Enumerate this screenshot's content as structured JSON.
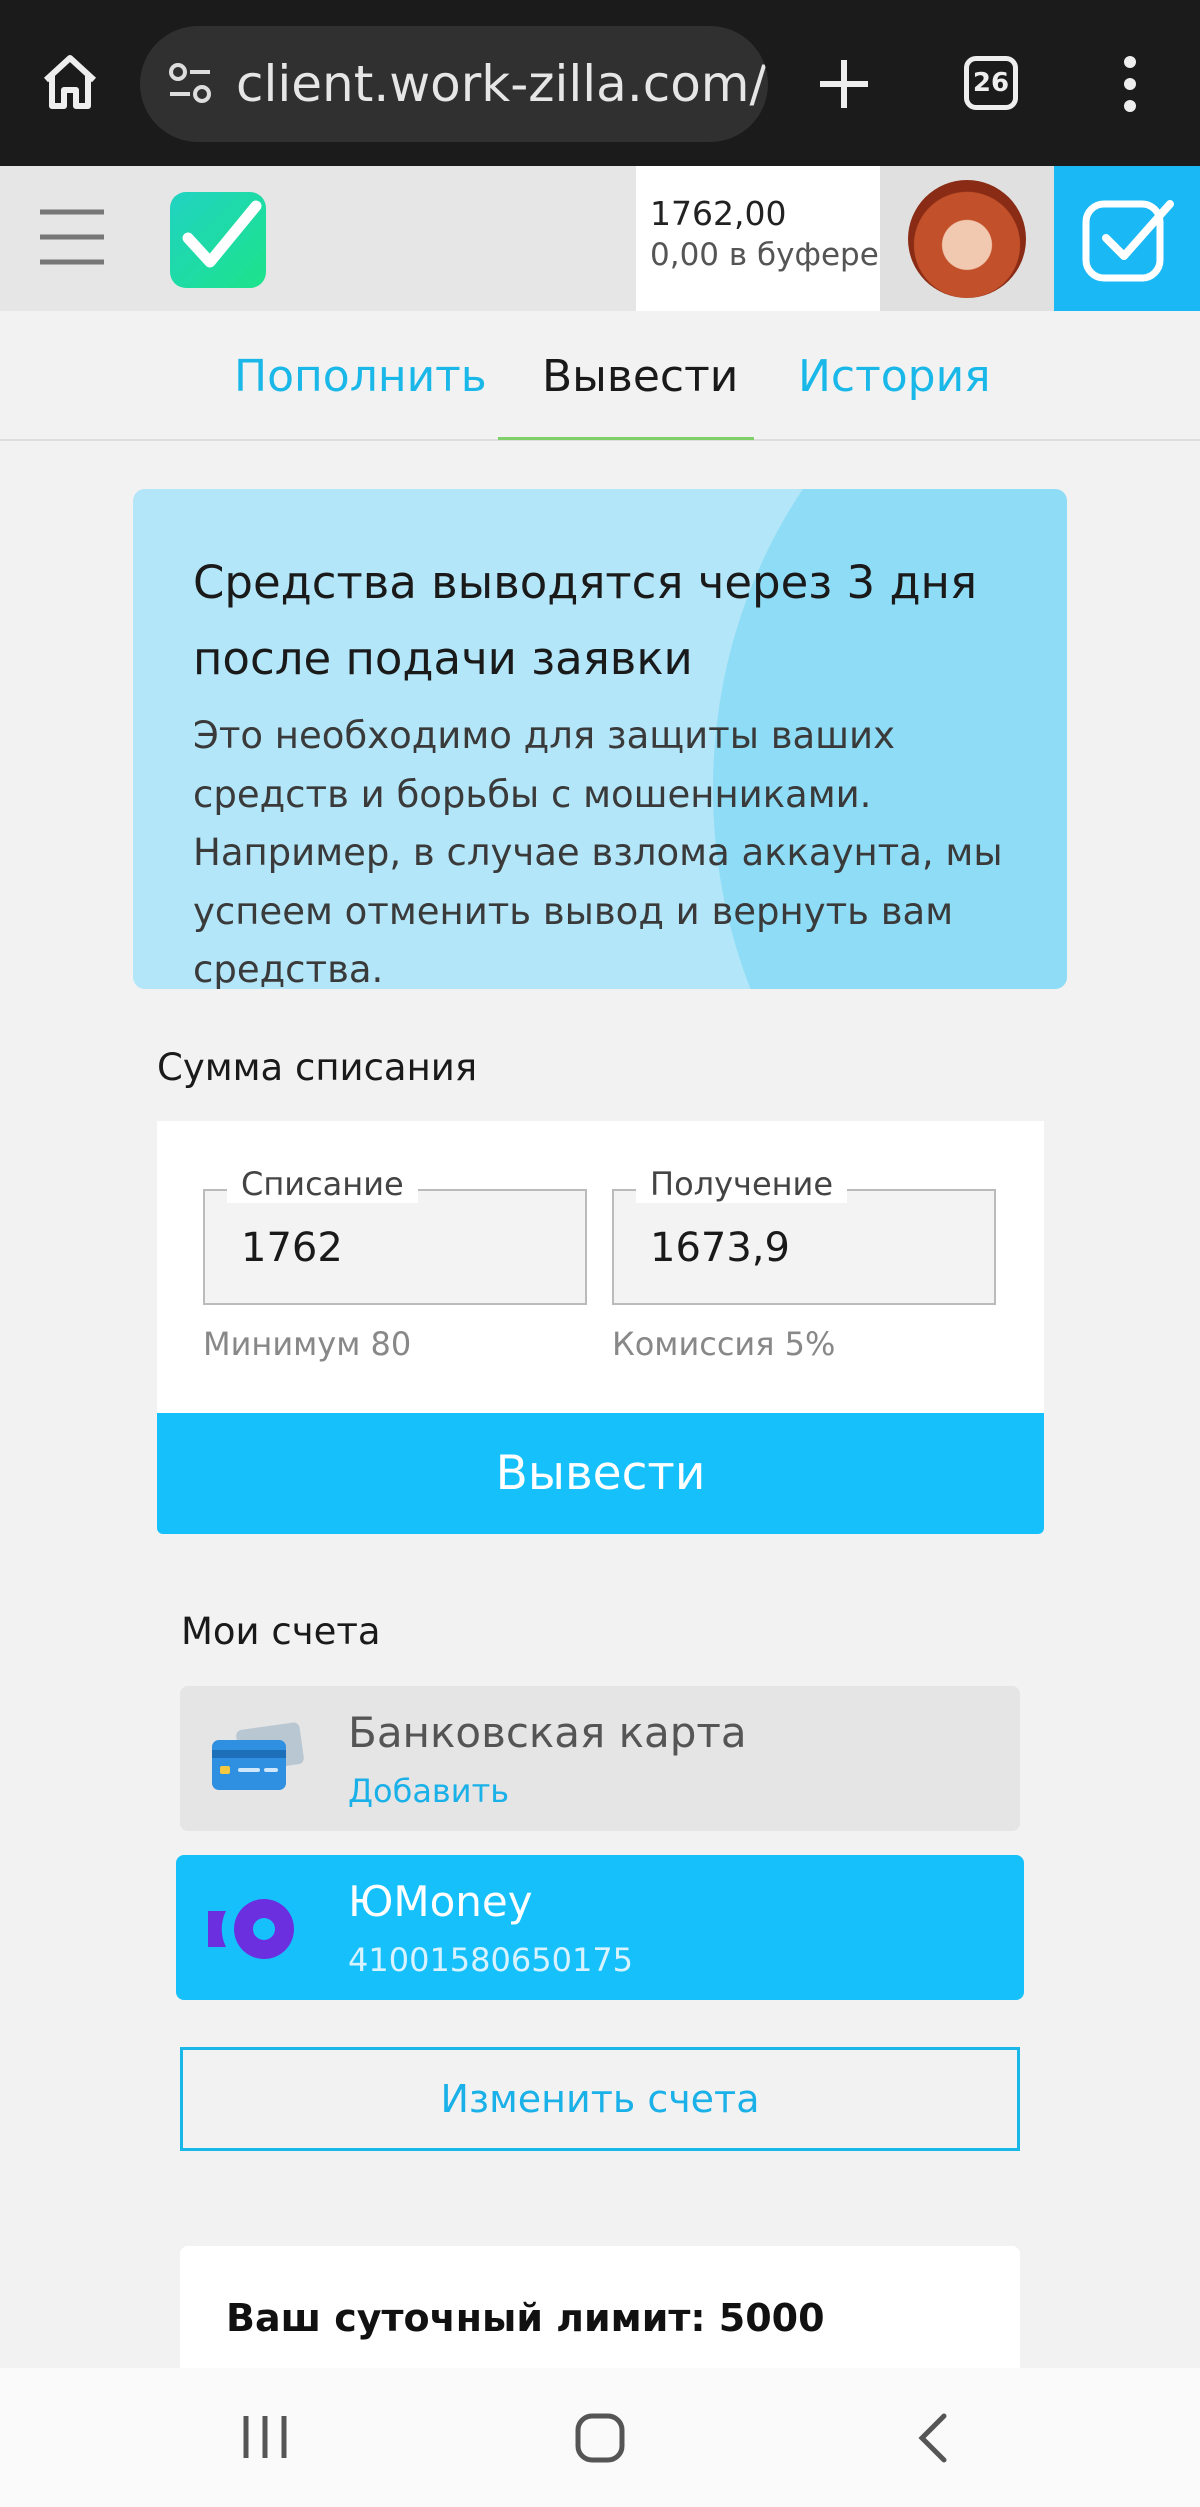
{
  "browser": {
    "url": "client.work-zilla.com/n",
    "tab_count": "26"
  },
  "header": {
    "balance": "1762,00",
    "buffer": "0,00 в буфере"
  },
  "tabs": [
    {
      "label": "Пополнить",
      "active": false
    },
    {
      "label": "Вывести",
      "active": true
    },
    {
      "label": "История",
      "active": false
    }
  ],
  "info": {
    "title": "Средства выводятся через 3 дня после подачи заявки",
    "text": "Это необходимо для защиты ваших средств и борьбы с мошенниками. Например, в случае взлома аккаунта, мы успеем отменить вывод и вернуть вам средства."
  },
  "amount": {
    "section_label": "Сумма списания",
    "debit_label": "Списание",
    "debit_value": "1762",
    "debit_hint": "Минимум 80",
    "receive_label": "Получение",
    "receive_value": "1673,9",
    "receive_hint": "Комиссия 5%",
    "submit_label": "Вывести"
  },
  "accounts": {
    "section_label": "Мои счета",
    "items": [
      {
        "title": "Банковская карта",
        "subtitle": "Добавить",
        "icon": "bank-card-icon",
        "selected": false
      },
      {
        "title": "ЮMoney",
        "subtitle": "41001580650175",
        "icon": "yoomoney-icon",
        "selected": true
      }
    ],
    "edit_label": "Изменить счета"
  },
  "limit": {
    "text": "Ваш суточный лимит: 5000"
  },
  "colors": {
    "accent": "#16c1fb",
    "link": "#1ab8e8",
    "info_bg": "#b2e6f8",
    "tab_underline": "#7fcf6a",
    "yoomoney_purple": "#6b2fe0"
  }
}
